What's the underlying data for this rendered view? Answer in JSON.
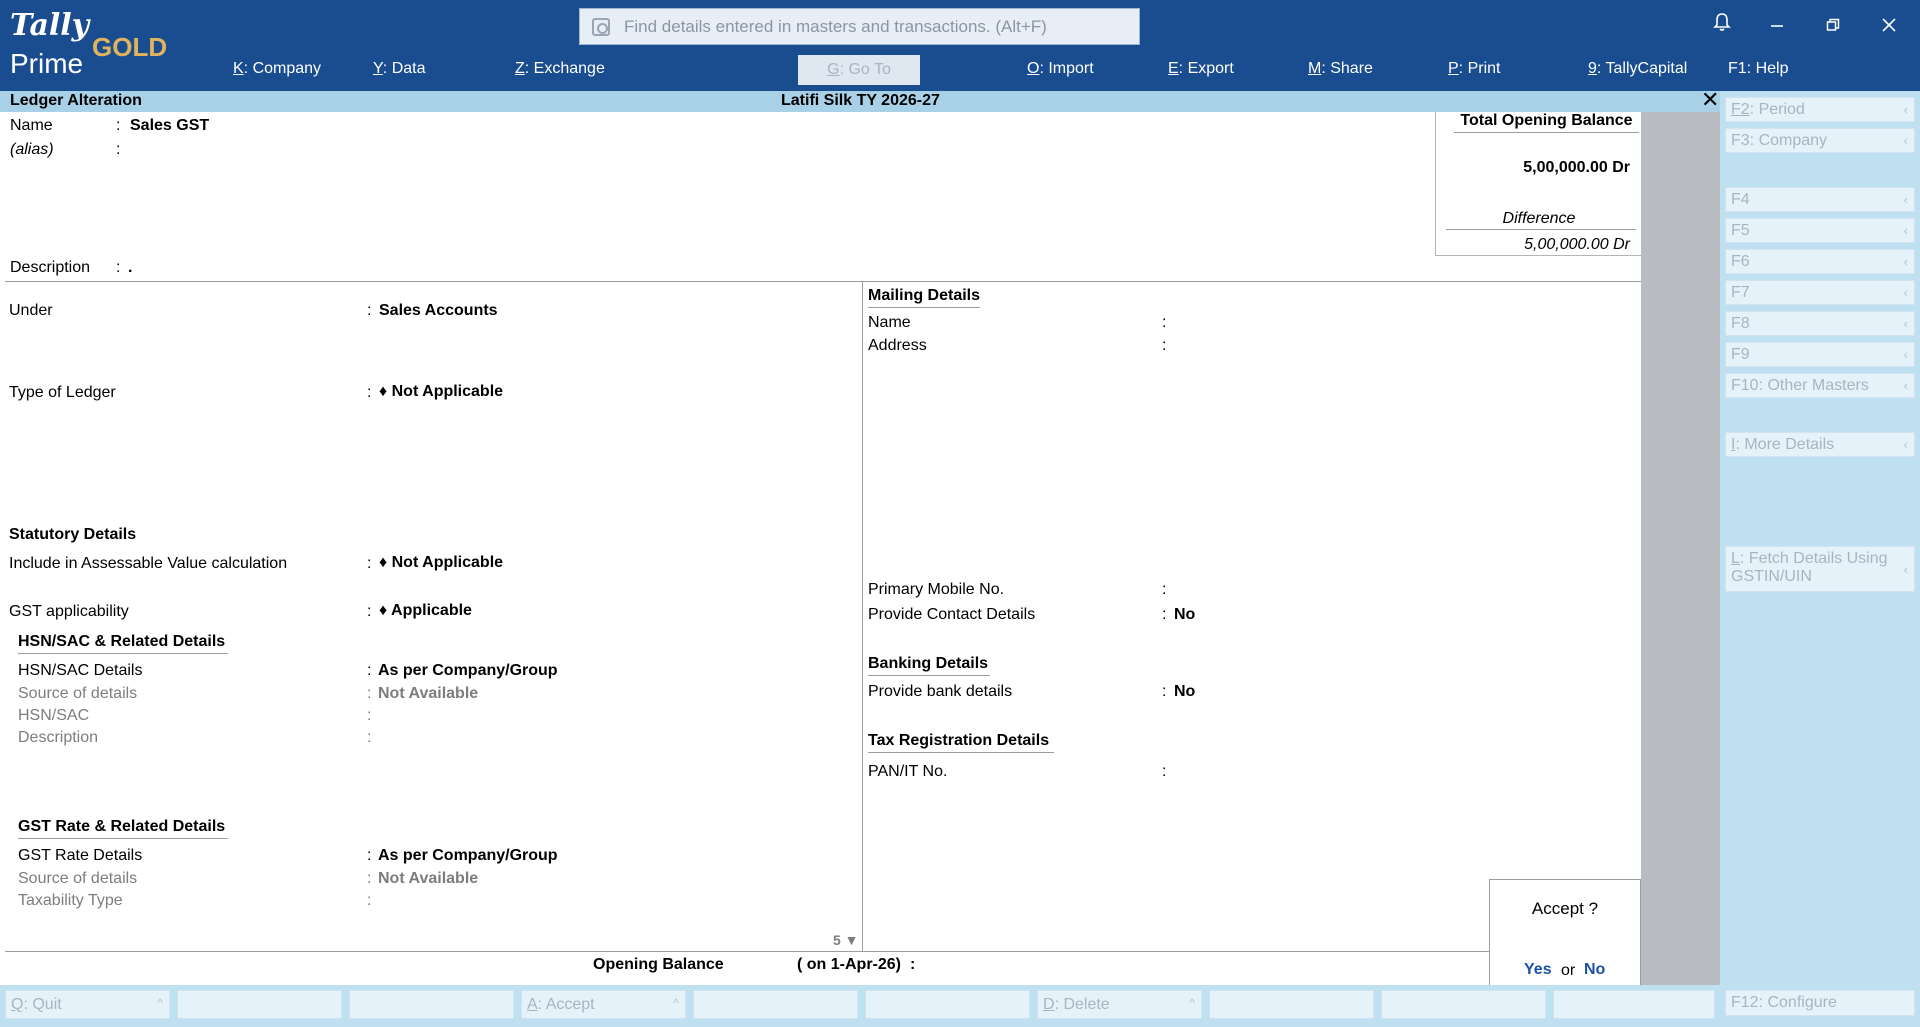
{
  "logo": {
    "tally": "Tally",
    "prime": "Prime",
    "gold": "GOLD"
  },
  "search": {
    "placeholder": "Find details entered in masters and transactions. (Alt+F)"
  },
  "window_controls": {
    "notify": "notification-bell-icon",
    "minimize": "minimize-icon",
    "restore": "restore-icon",
    "close": "close-icon"
  },
  "menu": [
    {
      "key": "K",
      "label": "Company"
    },
    {
      "key": "Y",
      "label": "Data"
    },
    {
      "key": "Z",
      "label": "Exchange"
    },
    {
      "key": "G",
      "label": "Go To"
    },
    {
      "key": "O",
      "label": "Import"
    },
    {
      "key": "E",
      "label": "Export"
    },
    {
      "key": "M",
      "label": "Share"
    },
    {
      "key": "P",
      "label": "Print"
    },
    {
      "key": "9",
      "label": "TallyCapital"
    },
    {
      "key": "F1",
      "label": "Help"
    }
  ],
  "titlebar": {
    "screen": "Ledger Alteration",
    "company": "Latifi Silk TY 2026-27"
  },
  "ledger": {
    "name_label": "Name",
    "name_value": "Sales GST",
    "alias_label": "(alias)",
    "description_label": "Description",
    "description_value": ".",
    "under_label": "Under",
    "under_value": "Sales Accounts",
    "type_label": "Type of Ledger",
    "type_value": "Not Applicable",
    "statutory_heading": "Statutory Details",
    "assessable_label": "Include in Assessable Value calculation",
    "assessable_value": "Not Applicable",
    "gst_app_label": "GST applicability",
    "gst_app_value": "Applicable",
    "hsn_heading": "HSN/SAC & Related Details",
    "hsn_details_label": "HSN/SAC Details",
    "hsn_details_value": "As per Company/Group",
    "hsn_source_label": "Source of details",
    "hsn_source_value": "Not Available",
    "hsn_label": "HSN/SAC",
    "hsn_desc_label": "Description",
    "gst_rate_heading": "GST Rate & Related Details",
    "gst_rate_label": "GST Rate Details",
    "gst_rate_value": "As per Company/Group",
    "rate_source_label": "Source of details",
    "rate_source_value": "Not Available",
    "taxability_label": "Taxability Type",
    "page_indicator": "5 ▼",
    "opening_label": "Opening Balance",
    "opening_date": "( on 1-Apr-26)"
  },
  "mailing": {
    "heading": "Mailing Details",
    "name_label": "Name",
    "address_label": "Address",
    "mobile_label": "Primary Mobile No.",
    "contact_label": "Provide Contact Details",
    "contact_value": "No",
    "banking_heading": "Banking Details",
    "bank_label": "Provide bank details",
    "bank_value": "No",
    "tax_heading": "Tax Registration Details",
    "pan_label": "PAN/IT No."
  },
  "balance": {
    "title": "Total Opening Balance",
    "amount": "5,00,000.00 Dr",
    "difference_label": "Difference",
    "difference_amount": "5,00,000.00 Dr"
  },
  "accept": {
    "question": "Accept ?",
    "yes": "Yes",
    "or": "or",
    "no": "No"
  },
  "side_buttons": [
    {
      "key": "F2",
      "label": "Period"
    },
    {
      "key": "F3",
      "label": "Company"
    },
    {
      "key": "F4",
      "label": ""
    },
    {
      "key": "F5",
      "label": ""
    },
    {
      "key": "F6",
      "label": ""
    },
    {
      "key": "F7",
      "label": ""
    },
    {
      "key": "F8",
      "label": ""
    },
    {
      "key": "F9",
      "label": ""
    },
    {
      "key": "F10",
      "label": "Other Masters"
    },
    {
      "key": "I",
      "label": "More Details"
    },
    {
      "key": "L",
      "label": "Fetch Details Using GSTIN/UIN"
    },
    {
      "key": "F12",
      "label": "Configure"
    }
  ],
  "bottom_buttons": [
    {
      "key": "Q",
      "label": "Quit"
    },
    {
      "key": "A",
      "label": "Accept"
    },
    {
      "key": "D",
      "label": "Delete"
    }
  ]
}
